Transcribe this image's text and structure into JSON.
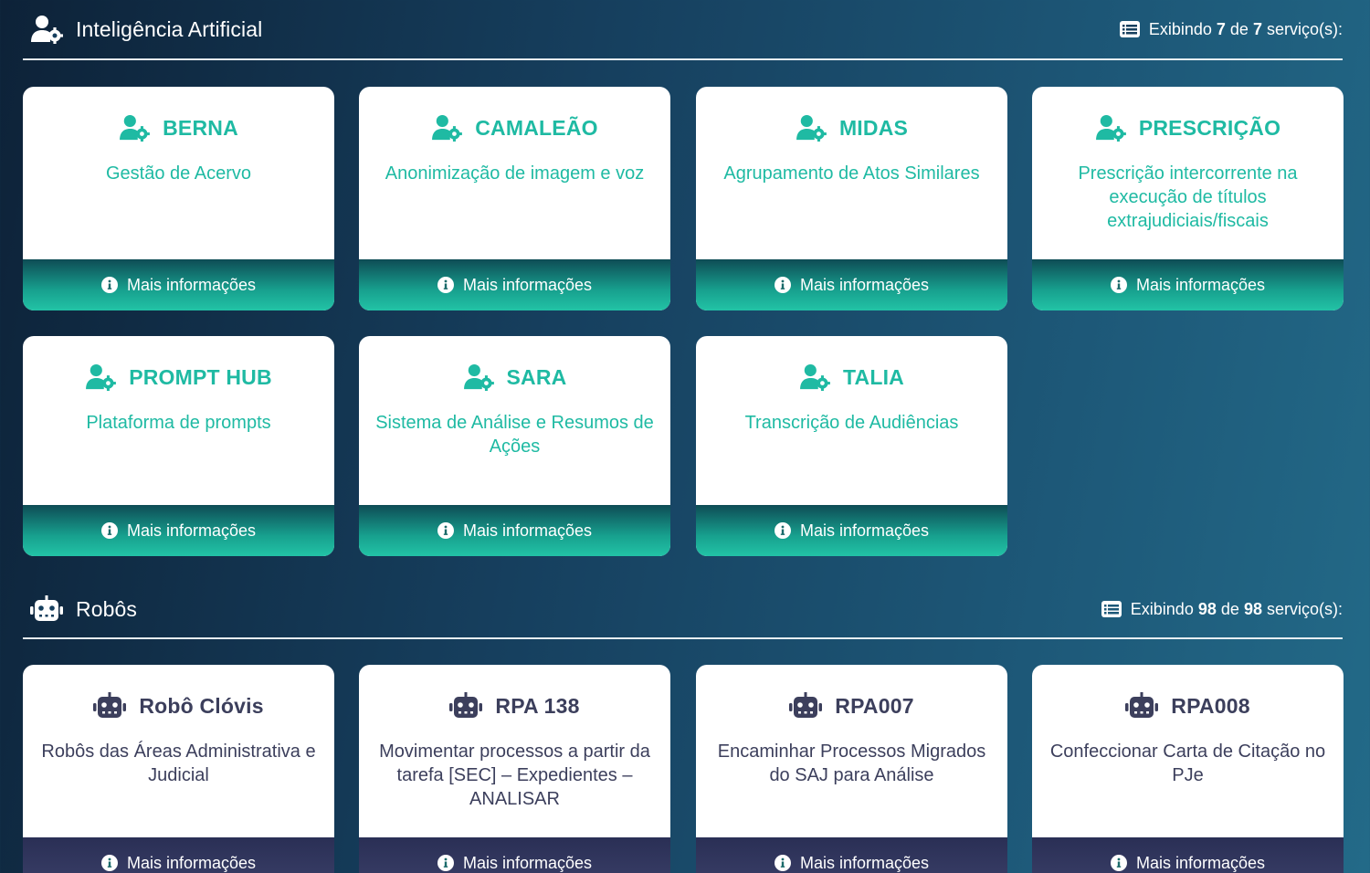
{
  "sections": {
    "ia": {
      "title": "Inteligência Artificial",
      "count_prefix": "Exibindo",
      "count_shown": "7",
      "count_mid": "de",
      "count_total": "7",
      "count_suffix": "serviço(s):",
      "icon": "user-gear-icon"
    },
    "robos": {
      "title": "Robôs",
      "count_prefix": "Exibindo",
      "count_shown": "98",
      "count_mid": "de",
      "count_total": "98",
      "count_suffix": "serviço(s):",
      "icon": "robot-icon"
    }
  },
  "more_info_label": "Mais informações",
  "ia_cards": [
    {
      "title": "BERNA",
      "desc": "Gestão de Acervo"
    },
    {
      "title": "CAMALEÃO",
      "desc": "Anonimização de imagem e voz"
    },
    {
      "title": "MIDAS",
      "desc": "Agrupamento de Atos Similares"
    },
    {
      "title": "PRESCRIÇÃO",
      "desc": "Prescrição intercorrente na execução de títulos extrajudiciais/fiscais"
    },
    {
      "title": "PROMPT HUB",
      "desc": "Plataforma de prompts"
    },
    {
      "title": "SARA",
      "desc": "Sistema de Análise e Resumos de Ações"
    },
    {
      "title": "TALIA",
      "desc": "Transcrição de Audiências"
    }
  ],
  "robo_cards": [
    {
      "title": "Robô Clóvis",
      "desc": "Robôs das Áreas Administrativa e Judicial"
    },
    {
      "title": "RPA 138",
      "desc": "Movimentar processos a partir da tarefa [SEC] – Expedientes – ANALISAR"
    },
    {
      "title": "RPA007",
      "desc": "Encaminhar Processos Migrados do SAJ para Análise"
    },
    {
      "title": "RPA008",
      "desc": "Confeccionar Carta de Citação no PJe"
    }
  ],
  "colors": {
    "ia_accent": "#1fbaa3",
    "robo_accent": "#3c3f5c",
    "background_dark": "#0d2238",
    "background_light": "#236a88"
  }
}
